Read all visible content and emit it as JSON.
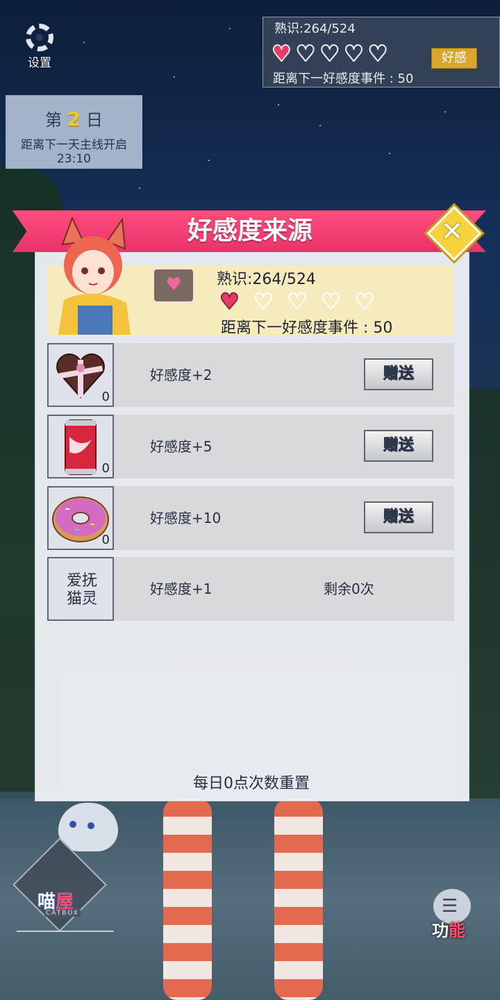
{
  "hud": {
    "settings_label": "设置",
    "day": {
      "prefix": "第",
      "number": "2",
      "suffix": "日",
      "next_label": "距离下一天主线开启",
      "time": "23:10"
    },
    "affection": {
      "title": "熟识:264/524",
      "hearts_filled": 1,
      "hearts_total": 5,
      "button": "好感",
      "next": "距离下一好感度事件 : 50"
    },
    "catbox": {
      "logo_a": "喵",
      "logo_b": "屋",
      "sub": "CATBOX"
    },
    "function": {
      "label_a": "功",
      "label_b": "能"
    }
  },
  "modal": {
    "title": "好感度来源",
    "close_icon": "close-x-icon",
    "info": {
      "bubble_icon": "heart-message-icon",
      "title": "熟识:264/524",
      "hearts_filled": 1,
      "hearts_total": 5,
      "next": "距离下一好感度事件 : 50"
    },
    "items": [
      {
        "icon": "chocolate-box-icon",
        "count": "0",
        "effect": "好感度+2",
        "action": "赠送"
      },
      {
        "icon": "soda-can-icon",
        "count": "0",
        "effect": "好感度+5",
        "action": "赠送"
      },
      {
        "icon": "donut-icon",
        "count": "0",
        "effect": "好感度+10",
        "action": "赠送"
      }
    ],
    "pet": {
      "label_line1": "爱抚",
      "label_line2": "猫灵",
      "effect": "好感度+1",
      "remaining": "剩余0次"
    },
    "footer": "每日0点次数重置"
  }
}
